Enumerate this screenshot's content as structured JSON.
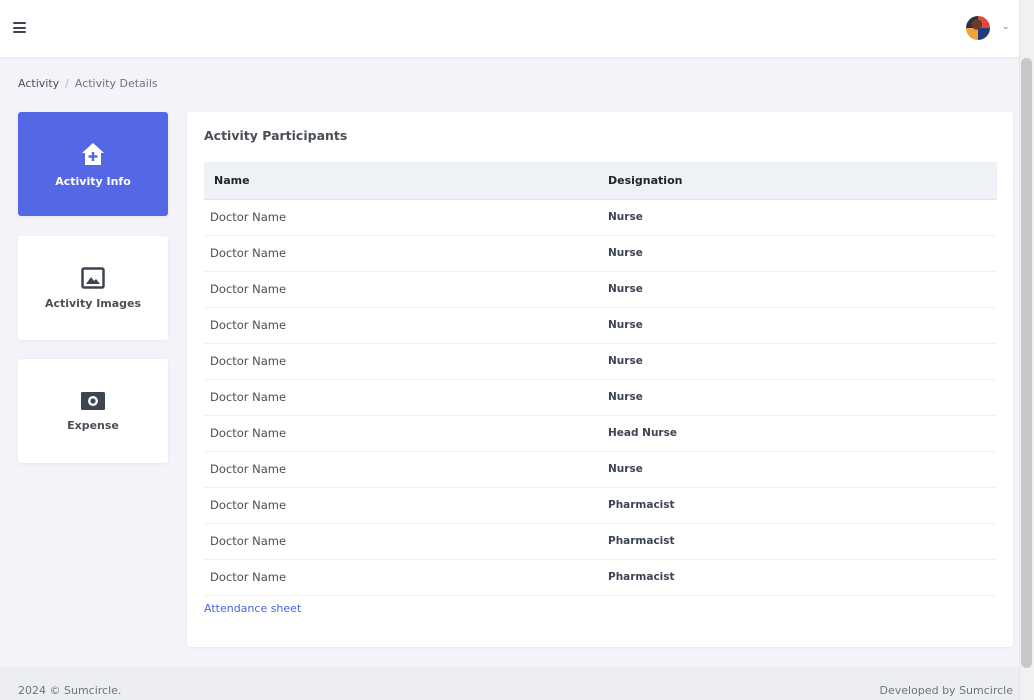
{
  "header": {
    "menu_icon": "hamburger-icon",
    "avatar_icon": "user-avatar",
    "caret": "⌄"
  },
  "breadcrumb": {
    "items": [
      "Activity",
      "Activity Details"
    ],
    "separator": "/"
  },
  "sidebar": {
    "tiles": [
      {
        "label": "Activity Info",
        "icon": "house-plus-icon",
        "active": true
      },
      {
        "label": "Activity Images",
        "icon": "image-icon",
        "active": false
      },
      {
        "label": "Expense",
        "icon": "money-icon",
        "active": false
      }
    ]
  },
  "main": {
    "title": "Activity Participants",
    "table": {
      "headers": [
        "Name",
        "Designation"
      ],
      "rows": [
        [
          "Doctor Name",
          "Nurse"
        ],
        [
          "Doctor Name",
          "Nurse"
        ],
        [
          "Doctor Name",
          "Nurse"
        ],
        [
          "Doctor Name",
          "Nurse"
        ],
        [
          "Doctor Name",
          "Nurse"
        ],
        [
          "Doctor Name",
          "Nurse"
        ],
        [
          "Doctor Name",
          "Head Nurse"
        ],
        [
          "Doctor Name",
          "Nurse"
        ],
        [
          "Doctor Name",
          "Pharmacist"
        ],
        [
          "Doctor Name",
          "Pharmacist"
        ],
        [
          "Doctor Name",
          "Pharmacist"
        ]
      ]
    },
    "attendance_link": "Attendance sheet"
  },
  "footer": {
    "left": "2024 © Sumcircle.",
    "right": "Developed by Sumcircle"
  },
  "colors": {
    "accent": "#5468e6",
    "link": "#4f63e0",
    "page_bg": "#f3f3f9"
  }
}
